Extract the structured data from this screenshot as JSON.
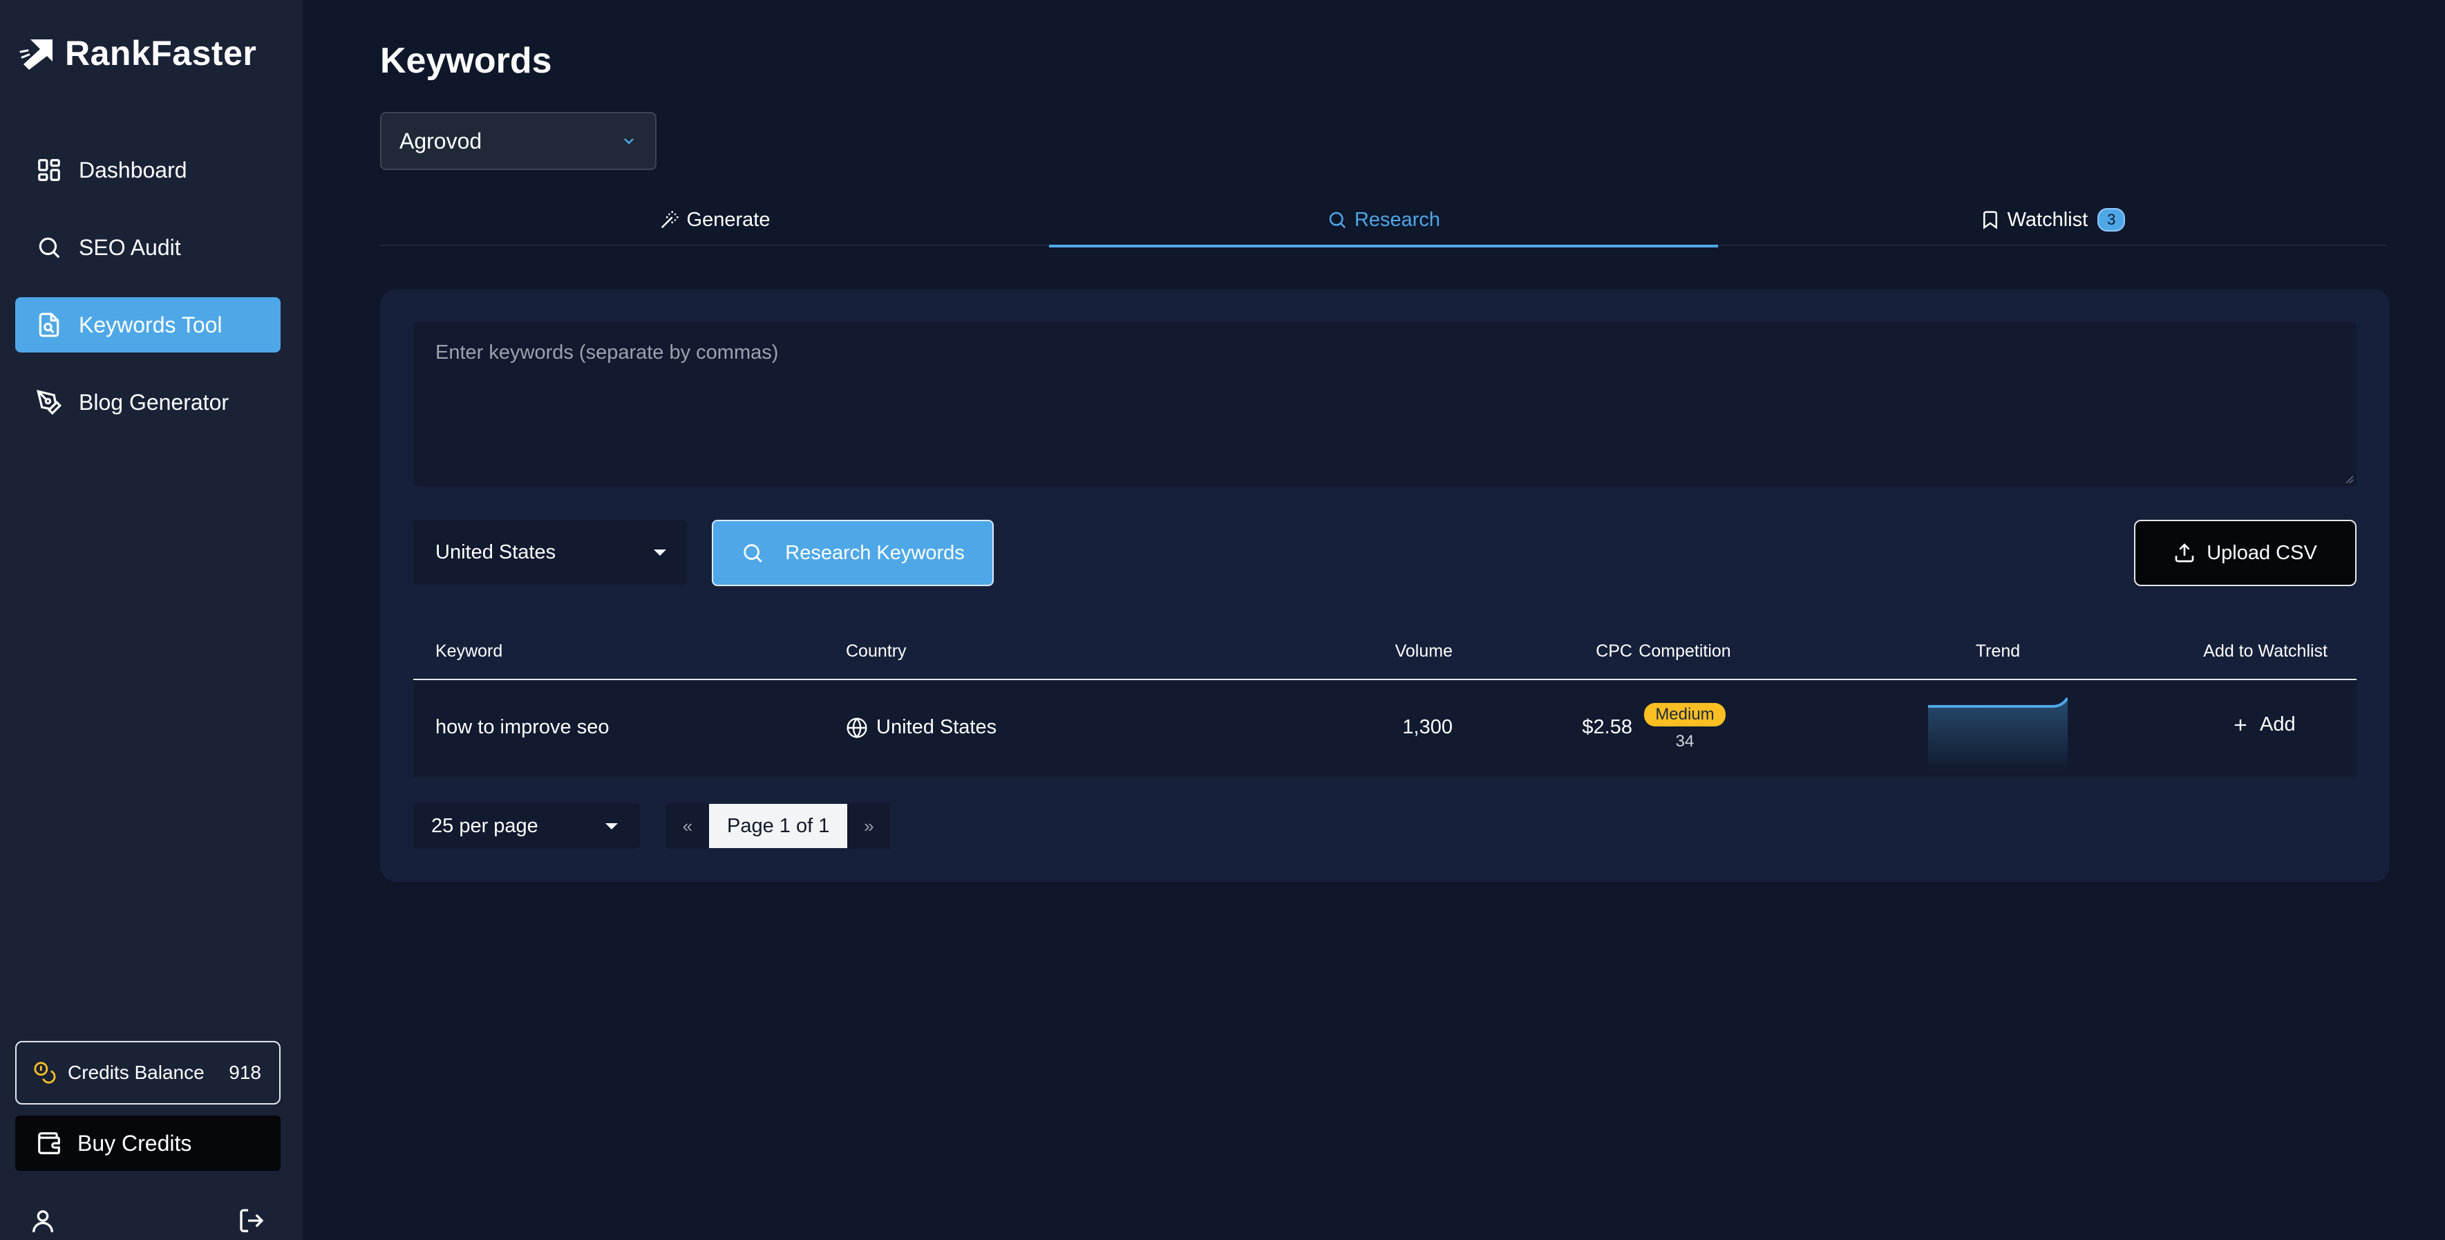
{
  "app": {
    "name": "RankFaster"
  },
  "sidebar": {
    "items": [
      {
        "label": "Dashboard",
        "icon": "dashboard-icon",
        "active": false
      },
      {
        "label": "SEO Audit",
        "icon": "search-icon",
        "active": false
      },
      {
        "label": "Keywords Tool",
        "icon": "file-search-icon",
        "active": true
      },
      {
        "label": "Blog Generator",
        "icon": "pen-tool-icon",
        "active": false
      }
    ],
    "credits": {
      "label": "Credits Balance",
      "value": "918",
      "icon": "coins-icon"
    },
    "buy_label": "Buy Credits"
  },
  "page": {
    "title": "Keywords",
    "project": "Agrovod"
  },
  "tabs": [
    {
      "label": "Generate",
      "icon": "magic-wand-icon",
      "active": false
    },
    {
      "label": "Research",
      "icon": "search-icon",
      "active": true
    },
    {
      "label": "Watchlist",
      "icon": "bookmark-icon",
      "active": false,
      "badge": "3"
    }
  ],
  "research": {
    "placeholder": "Enter keywords (separate by commas)",
    "country": "United States",
    "research_button": "Research Keywords",
    "upload_button": "Upload CSV"
  },
  "table": {
    "headers": {
      "keyword": "Keyword",
      "country": "Country",
      "volume": "Volume",
      "cpc": "CPC",
      "competition": "Competition",
      "trend": "Trend",
      "watchlist": "Add to Watchlist"
    },
    "rows": [
      {
        "keyword": "how to improve seo",
        "country": "United States",
        "volume": "1,300",
        "cpc": "$2.58",
        "competition": "Medium",
        "competition_score": "34",
        "add_label": "Add",
        "trend_color": "#4ea8e8"
      }
    ]
  },
  "pagination": {
    "per_page": "25 per page",
    "first": "«",
    "label": "Page 1 of 1",
    "last": "»"
  },
  "colors": {
    "accent": "#4ea8e8",
    "background": "#0f172a",
    "sidebar": "#1a2236",
    "medium_badge": "#fbbf24"
  }
}
